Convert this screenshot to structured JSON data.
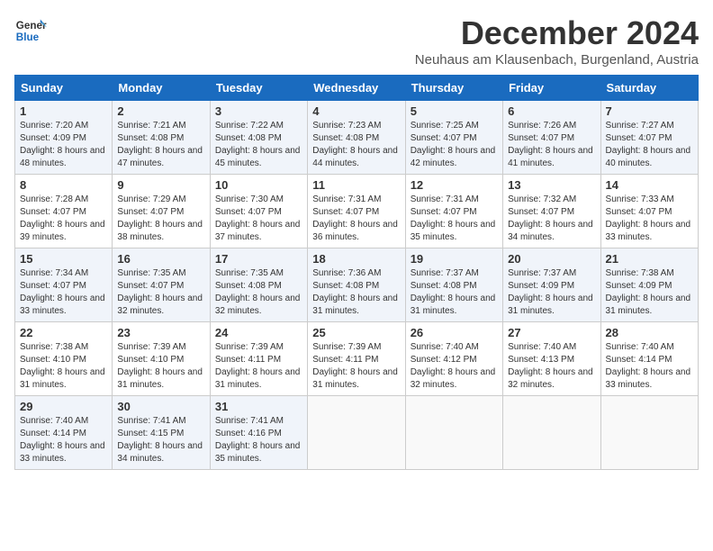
{
  "logo": {
    "line1": "General",
    "line2": "Blue"
  },
  "title": "December 2024",
  "subtitle": "Neuhaus am Klausenbach, Burgenland, Austria",
  "weekdays": [
    "Sunday",
    "Monday",
    "Tuesday",
    "Wednesday",
    "Thursday",
    "Friday",
    "Saturday"
  ],
  "weeks": [
    [
      {
        "day": "1",
        "sunrise": "7:20 AM",
        "sunset": "4:09 PM",
        "daylight": "8 hours and 48 minutes."
      },
      {
        "day": "2",
        "sunrise": "7:21 AM",
        "sunset": "4:08 PM",
        "daylight": "8 hours and 47 minutes."
      },
      {
        "day": "3",
        "sunrise": "7:22 AM",
        "sunset": "4:08 PM",
        "daylight": "8 hours and 45 minutes."
      },
      {
        "day": "4",
        "sunrise": "7:23 AM",
        "sunset": "4:08 PM",
        "daylight": "8 hours and 44 minutes."
      },
      {
        "day": "5",
        "sunrise": "7:25 AM",
        "sunset": "4:07 PM",
        "daylight": "8 hours and 42 minutes."
      },
      {
        "day": "6",
        "sunrise": "7:26 AM",
        "sunset": "4:07 PM",
        "daylight": "8 hours and 41 minutes."
      },
      {
        "day": "7",
        "sunrise": "7:27 AM",
        "sunset": "4:07 PM",
        "daylight": "8 hours and 40 minutes."
      }
    ],
    [
      {
        "day": "8",
        "sunrise": "7:28 AM",
        "sunset": "4:07 PM",
        "daylight": "8 hours and 39 minutes."
      },
      {
        "day": "9",
        "sunrise": "7:29 AM",
        "sunset": "4:07 PM",
        "daylight": "8 hours and 38 minutes."
      },
      {
        "day": "10",
        "sunrise": "7:30 AM",
        "sunset": "4:07 PM",
        "daylight": "8 hours and 37 minutes."
      },
      {
        "day": "11",
        "sunrise": "7:31 AM",
        "sunset": "4:07 PM",
        "daylight": "8 hours and 36 minutes."
      },
      {
        "day": "12",
        "sunrise": "7:31 AM",
        "sunset": "4:07 PM",
        "daylight": "8 hours and 35 minutes."
      },
      {
        "day": "13",
        "sunrise": "7:32 AM",
        "sunset": "4:07 PM",
        "daylight": "8 hours and 34 minutes."
      },
      {
        "day": "14",
        "sunrise": "7:33 AM",
        "sunset": "4:07 PM",
        "daylight": "8 hours and 33 minutes."
      }
    ],
    [
      {
        "day": "15",
        "sunrise": "7:34 AM",
        "sunset": "4:07 PM",
        "daylight": "8 hours and 33 minutes."
      },
      {
        "day": "16",
        "sunrise": "7:35 AM",
        "sunset": "4:07 PM",
        "daylight": "8 hours and 32 minutes."
      },
      {
        "day": "17",
        "sunrise": "7:35 AM",
        "sunset": "4:08 PM",
        "daylight": "8 hours and 32 minutes."
      },
      {
        "day": "18",
        "sunrise": "7:36 AM",
        "sunset": "4:08 PM",
        "daylight": "8 hours and 31 minutes."
      },
      {
        "day": "19",
        "sunrise": "7:37 AM",
        "sunset": "4:08 PM",
        "daylight": "8 hours and 31 minutes."
      },
      {
        "day": "20",
        "sunrise": "7:37 AM",
        "sunset": "4:09 PM",
        "daylight": "8 hours and 31 minutes."
      },
      {
        "day": "21",
        "sunrise": "7:38 AM",
        "sunset": "4:09 PM",
        "daylight": "8 hours and 31 minutes."
      }
    ],
    [
      {
        "day": "22",
        "sunrise": "7:38 AM",
        "sunset": "4:10 PM",
        "daylight": "8 hours and 31 minutes."
      },
      {
        "day": "23",
        "sunrise": "7:39 AM",
        "sunset": "4:10 PM",
        "daylight": "8 hours and 31 minutes."
      },
      {
        "day": "24",
        "sunrise": "7:39 AM",
        "sunset": "4:11 PM",
        "daylight": "8 hours and 31 minutes."
      },
      {
        "day": "25",
        "sunrise": "7:39 AM",
        "sunset": "4:11 PM",
        "daylight": "8 hours and 31 minutes."
      },
      {
        "day": "26",
        "sunrise": "7:40 AM",
        "sunset": "4:12 PM",
        "daylight": "8 hours and 32 minutes."
      },
      {
        "day": "27",
        "sunrise": "7:40 AM",
        "sunset": "4:13 PM",
        "daylight": "8 hours and 32 minutes."
      },
      {
        "day": "28",
        "sunrise": "7:40 AM",
        "sunset": "4:14 PM",
        "daylight": "8 hours and 33 minutes."
      }
    ],
    [
      {
        "day": "29",
        "sunrise": "7:40 AM",
        "sunset": "4:14 PM",
        "daylight": "8 hours and 33 minutes."
      },
      {
        "day": "30",
        "sunrise": "7:41 AM",
        "sunset": "4:15 PM",
        "daylight": "8 hours and 34 minutes."
      },
      {
        "day": "31",
        "sunrise": "7:41 AM",
        "sunset": "4:16 PM",
        "daylight": "8 hours and 35 minutes."
      },
      null,
      null,
      null,
      null
    ]
  ]
}
